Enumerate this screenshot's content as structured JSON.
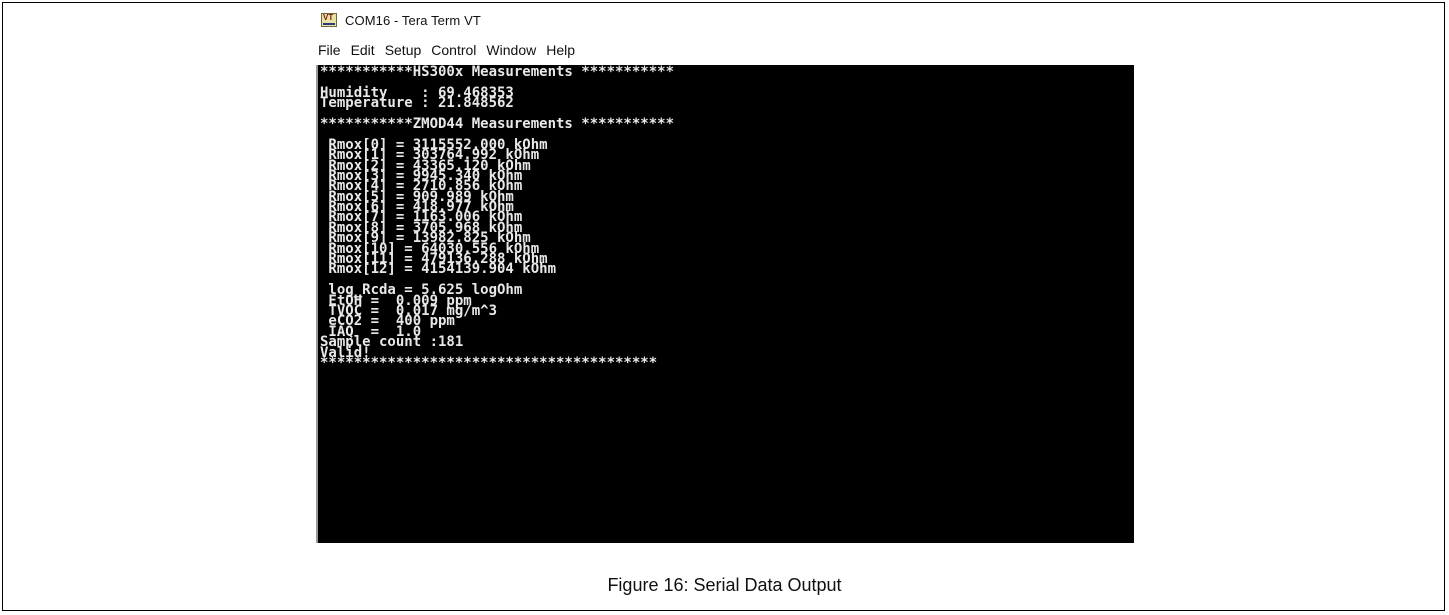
{
  "window": {
    "title": "COM16 - Tera Term VT",
    "app_icon": "tera-term-icon"
  },
  "menu": {
    "items": [
      "File",
      "Edit",
      "Setup",
      "Control",
      "Window",
      "Help"
    ]
  },
  "terminal": {
    "lines": [
      "***********HS300x Measurements ***********",
      "",
      "Humidity    : 69.468353",
      "Temperature : 21.848562",
      "",
      "***********ZMOD44 Measurements ***********",
      "",
      " Rmox[0] = 3115552.000 kOhm",
      " Rmox[1] = 303764.992 kOhm",
      " Rmox[2] = 43365.120 kOhm",
      " Rmox[3] = 9945.340 kOhm",
      " Rmox[4] = 2710.856 kOhm",
      " Rmox[5] = 909.989 kOhm",
      " Rmox[6] = 418.977 kOhm",
      " Rmox[7] = 1163.006 kOhm",
      " Rmox[8] = 3705.968 kOhm",
      " Rmox[9] = 13982.825 kOhm",
      " Rmox[10] = 64030.556 kOhm",
      " Rmox[11] = 479136.288 kOhm",
      " Rmox[12] = 4154139.904 kOhm",
      "",
      " log_Rcda = 5.625 logOhm",
      " EtOH =  0.009 ppm",
      " TVOC =  0.017 mg/m^3",
      " eCO2 =  400 ppm",
      " IAQ  =  1.0",
      "Sample count :181",
      "Valid!",
      "****************************************"
    ]
  },
  "caption": "Figure 16: Serial Data Output"
}
